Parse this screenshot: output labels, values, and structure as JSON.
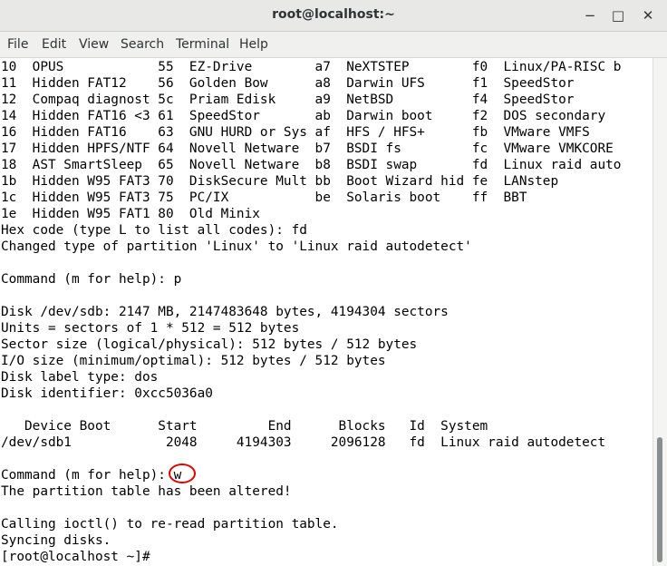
{
  "window": {
    "title": "root@localhost:~"
  },
  "menu": [
    "File",
    "Edit",
    "View",
    "Search",
    "Terminal",
    "Help"
  ],
  "controls": {
    "minimize": "−",
    "maximize": "□",
    "close": "✕"
  },
  "terminal_lines": [
    "10  OPUS            55  EZ-Drive        a7  NeXTSTEP        f0  Linux/PA-RISC b",
    "11  Hidden FAT12    56  Golden Bow      a8  Darwin UFS      f1  SpeedStor",
    "12  Compaq diagnost 5c  Priam Edisk     a9  NetBSD          f4  SpeedStor",
    "14  Hidden FAT16 <3 61  SpeedStor       ab  Darwin boot     f2  DOS secondary",
    "16  Hidden FAT16    63  GNU HURD or Sys af  HFS / HFS+      fb  VMware VMFS",
    "17  Hidden HPFS/NTF 64  Novell Netware  b7  BSDI fs         fc  VMware VMKCORE",
    "18  AST SmartSleep  65  Novell Netware  b8  BSDI swap       fd  Linux raid auto",
    "1b  Hidden W95 FAT3 70  DiskSecure Mult bb  Boot Wizard hid fe  LANstep",
    "1c  Hidden W95 FAT3 75  PC/IX           be  Solaris boot    ff  BBT",
    "1e  Hidden W95 FAT1 80  Old Minix",
    "Hex code (type L to list all codes): fd",
    "Changed type of partition 'Linux' to 'Linux raid autodetect'",
    "",
    "Command (m for help): p",
    "",
    "Disk /dev/sdb: 2147 MB, 2147483648 bytes, 4194304 sectors",
    "Units = sectors of 1 * 512 = 512 bytes",
    "Sector size (logical/physical): 512 bytes / 512 bytes",
    "I/O size (minimum/optimal): 512 bytes / 512 bytes",
    "Disk label type: dos",
    "Disk identifier: 0xcc5036a0",
    "",
    "   Device Boot      Start         End      Blocks   Id  System",
    "/dev/sdb1            2048     4194303     2096128   fd  Linux raid autodetect",
    "",
    "Command (m for help): w",
    "The partition table has been altered!",
    "",
    "Calling ioctl() to re-read partition table.",
    "Syncing disks.",
    "[root@localhost ~]#"
  ],
  "colors": {
    "annotation": "#e00000"
  }
}
